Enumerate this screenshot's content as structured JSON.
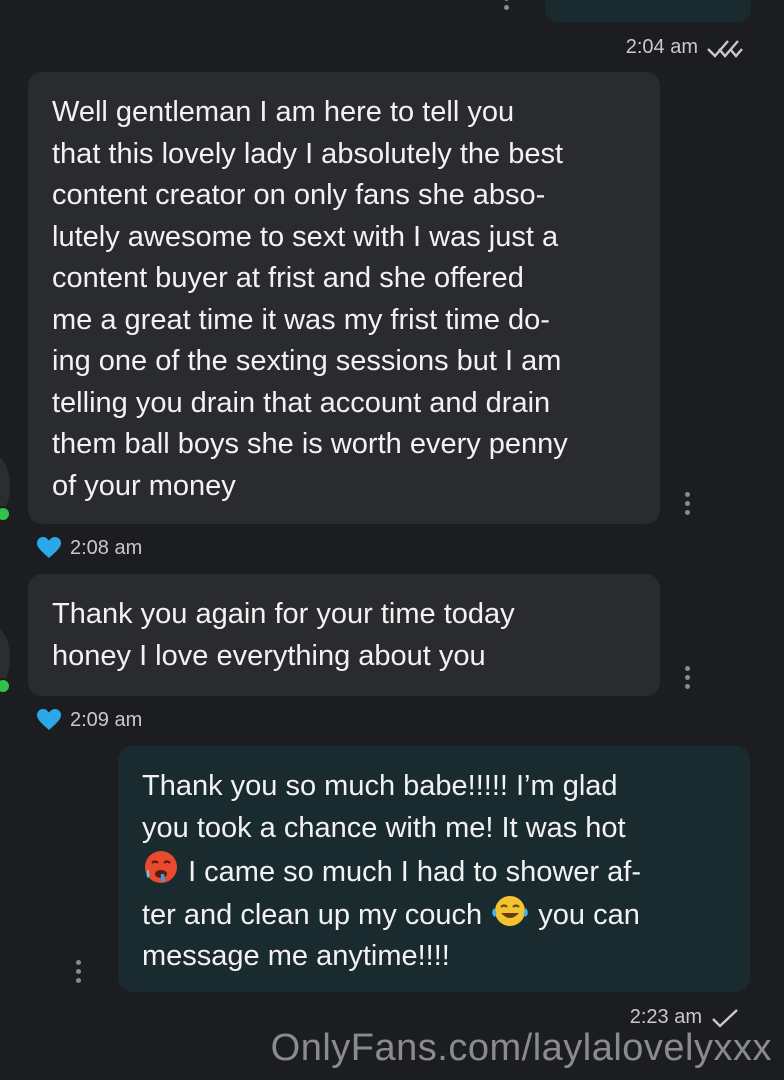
{
  "chat": {
    "top_time": "2:04 am",
    "messages": [
      {
        "lines": [
          "Well gentleman I am here to tell you",
          "that this lovely lady I absolutely the best",
          "content creator on only fans she abso-",
          "lutely awesome to sext with I was just a",
          "content buyer at frist and she offered",
          "me a great time it was my frist time do-",
          "ing one of the sexting sessions but I am",
          "telling you drain that account and drain",
          "them ball boys she is worth every penny",
          "of your money"
        ],
        "time": "2:08 am"
      },
      {
        "lines": [
          "Thank you again for your time today",
          "honey I love everything about you"
        ],
        "time": "2:09 am"
      }
    ],
    "reply": {
      "line1": "Thank you so much babe!!!!! I’m glad",
      "line2": "you took a chance with me! It was hot",
      "line3": "I came so much I had to shower af-",
      "line4a": "ter and clean up my couch",
      "line4b": "you can",
      "line5": "message me anytime!!!!",
      "time": "2:23 am"
    }
  },
  "watermark": "OnlyFans.com/laylalovelyxxx",
  "colors": {
    "background": "#1c1d20",
    "incoming_bubble": "#2a2b2e",
    "outgoing_bubble": "#1a2b30",
    "heart": "#2aa8e8",
    "online": "#32c24a"
  }
}
